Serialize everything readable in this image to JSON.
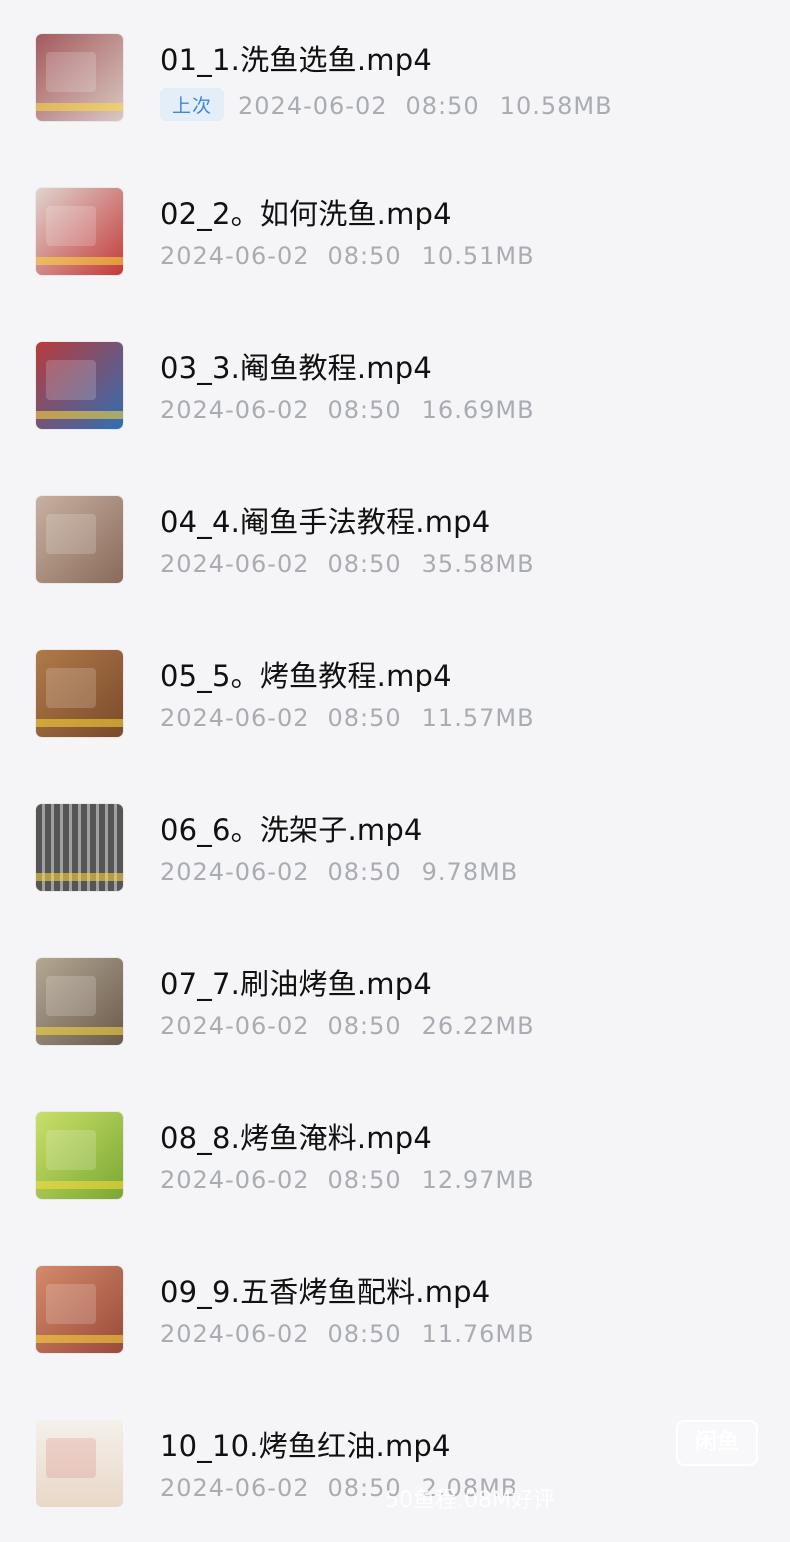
{
  "files": [
    {
      "name": "01_1.洗鱼选鱼.mp4",
      "badge": "上次",
      "date": "2024-06-02",
      "time": "08:50",
      "size": "10.58MB",
      "thumb_color": "#a45a5f",
      "thumb_color2": "#d9c8c0"
    },
    {
      "name": "02_2。如何洗鱼.mp4",
      "date": "2024-06-02",
      "time": "08:50",
      "size": "10.51MB",
      "thumb_color": "#c33a3a",
      "thumb_color2": "#e0d4cf"
    },
    {
      "name": "03_3.阉鱼教程.mp4",
      "date": "2024-06-02",
      "time": "08:50",
      "size": "16.69MB",
      "thumb_color": "#2f6fb5",
      "thumb_color2": "#b83b3b"
    },
    {
      "name": "04_4.阉鱼手法教程.mp4",
      "date": "2024-06-02",
      "time": "08:50",
      "size": "35.58MB",
      "thumb_color": "#8a6a5a",
      "thumb_color2": "#c7b1a0"
    },
    {
      "name": "05_5。烤鱼教程.mp4",
      "date": "2024-06-02",
      "time": "08:50",
      "size": "11.57MB",
      "thumb_color": "#7a4a2a",
      "thumb_color2": "#b07a4a"
    },
    {
      "name": "06_6。洗架子.mp4",
      "date": "2024-06-02",
      "time": "08:50",
      "size": "9.78MB",
      "thumb_color": "#555555",
      "thumb_color2": "#a0a0a0"
    },
    {
      "name": "07_7.刷油烤鱼.mp4",
      "date": "2024-06-02",
      "time": "08:50",
      "size": "26.22MB",
      "thumb_color": "#6a5a4a",
      "thumb_color2": "#b4a894"
    },
    {
      "name": "08_8.烤鱼淹料.mp4",
      "date": "2024-06-02",
      "time": "08:50",
      "size": "12.97MB",
      "thumb_color": "#7aa832",
      "thumb_color2": "#c9e06a"
    },
    {
      "name": "09_9.五香烤鱼配料.mp4",
      "date": "2024-06-02",
      "time": "08:50",
      "size": "11.76MB",
      "thumb_color": "#9a4a3a",
      "thumb_color2": "#d48a6a"
    },
    {
      "name": "10_10.烤鱼红油.mp4",
      "date": "2024-06-02",
      "time": "08:50",
      "size": "2.08MB",
      "thumb_color": "#f4f0ea",
      "thumb_color2": "#e8d8c8"
    }
  ],
  "watermark": "闲鱼",
  "overlay": "50鱼程.08M好评"
}
